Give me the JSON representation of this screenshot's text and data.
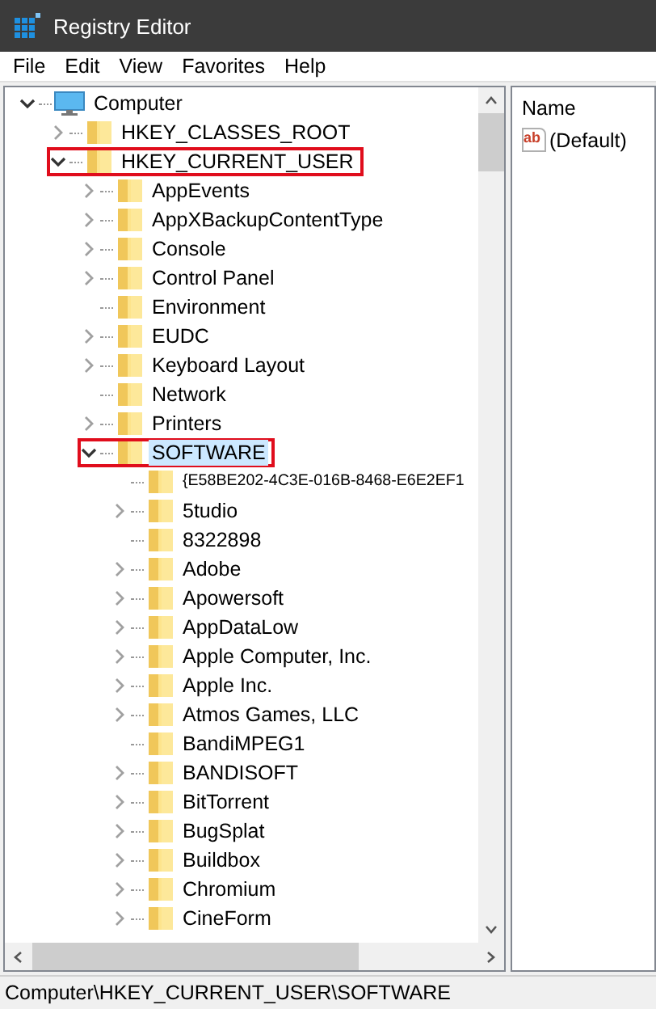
{
  "window": {
    "title": "Registry Editor"
  },
  "menu": [
    "File",
    "Edit",
    "View",
    "Favorites",
    "Help"
  ],
  "tree": [
    {
      "label": "Computer",
      "kind": "computer",
      "expanded": true,
      "selected": false,
      "highlighted": false,
      "children": [
        {
          "label": "HKEY_CLASSES_ROOT",
          "kind": "folder",
          "expanded": false,
          "selected": false,
          "highlighted": false
        },
        {
          "label": "HKEY_CURRENT_USER",
          "kind": "folder",
          "expanded": true,
          "selected": false,
          "highlighted": true,
          "children": [
            {
              "label": "AppEvents",
              "kind": "folder",
              "expanded": false,
              "selected": false,
              "highlighted": false
            },
            {
              "label": "AppXBackupContentType",
              "kind": "folder",
              "expanded": false,
              "selected": false,
              "highlighted": false
            },
            {
              "label": "Console",
              "kind": "folder",
              "expanded": false,
              "selected": false,
              "highlighted": false
            },
            {
              "label": "Control Panel",
              "kind": "folder",
              "expanded": false,
              "selected": false,
              "highlighted": false
            },
            {
              "label": "Environment",
              "kind": "folder",
              "selected": false,
              "highlighted": false
            },
            {
              "label": "EUDC",
              "kind": "folder",
              "expanded": false,
              "selected": false,
              "highlighted": false
            },
            {
              "label": "Keyboard Layout",
              "kind": "folder",
              "expanded": false,
              "selected": false,
              "highlighted": false
            },
            {
              "label": "Network",
              "kind": "folder",
              "selected": false,
              "highlighted": false
            },
            {
              "label": "Printers",
              "kind": "folder",
              "expanded": false,
              "selected": false,
              "highlighted": false
            },
            {
              "label": "SOFTWARE",
              "kind": "folder",
              "expanded": true,
              "selected": true,
              "highlighted": true,
              "children": [
                {
                  "label": "{E58BE202-4C3E-016B-8468-E6E2EF1",
                  "kind": "folder",
                  "selected": false,
                  "highlighted": false
                },
                {
                  "label": "5tudio",
                  "kind": "folder",
                  "expanded": false,
                  "selected": false,
                  "highlighted": false
                },
                {
                  "label": "8322898",
                  "kind": "folder",
                  "selected": false,
                  "highlighted": false
                },
                {
                  "label": "Adobe",
                  "kind": "folder",
                  "expanded": false,
                  "selected": false,
                  "highlighted": false
                },
                {
                  "label": "Apowersoft",
                  "kind": "folder",
                  "expanded": false,
                  "selected": false,
                  "highlighted": false
                },
                {
                  "label": "AppDataLow",
                  "kind": "folder",
                  "expanded": false,
                  "selected": false,
                  "highlighted": false
                },
                {
                  "label": "Apple Computer, Inc.",
                  "kind": "folder",
                  "expanded": false,
                  "selected": false,
                  "highlighted": false
                },
                {
                  "label": "Apple Inc.",
                  "kind": "folder",
                  "expanded": false,
                  "selected": false,
                  "highlighted": false
                },
                {
                  "label": "Atmos Games, LLC",
                  "kind": "folder",
                  "expanded": false,
                  "selected": false,
                  "highlighted": false
                },
                {
                  "label": "BandiMPEG1",
                  "kind": "folder",
                  "selected": false,
                  "highlighted": false
                },
                {
                  "label": "BANDISOFT",
                  "kind": "folder",
                  "expanded": false,
                  "selected": false,
                  "highlighted": false
                },
                {
                  "label": "BitTorrent",
                  "kind": "folder",
                  "expanded": false,
                  "selected": false,
                  "highlighted": false
                },
                {
                  "label": "BugSplat",
                  "kind": "folder",
                  "expanded": false,
                  "selected": false,
                  "highlighted": false
                },
                {
                  "label": "Buildbox",
                  "kind": "folder",
                  "expanded": false,
                  "selected": false,
                  "highlighted": false
                },
                {
                  "label": "Chromium",
                  "kind": "folder",
                  "expanded": false,
                  "selected": false,
                  "highlighted": false
                },
                {
                  "label": "CineForm",
                  "kind": "folder",
                  "expanded": false,
                  "selected": false,
                  "highlighted": false
                }
              ]
            }
          ]
        }
      ]
    }
  ],
  "values_pane": {
    "column_header": "Name",
    "values": [
      {
        "name": "(Default)",
        "kind": "string",
        "icon_text": "ab"
      }
    ]
  },
  "status_bar": "Computer\\HKEY_CURRENT_USER\\SOFTWARE"
}
